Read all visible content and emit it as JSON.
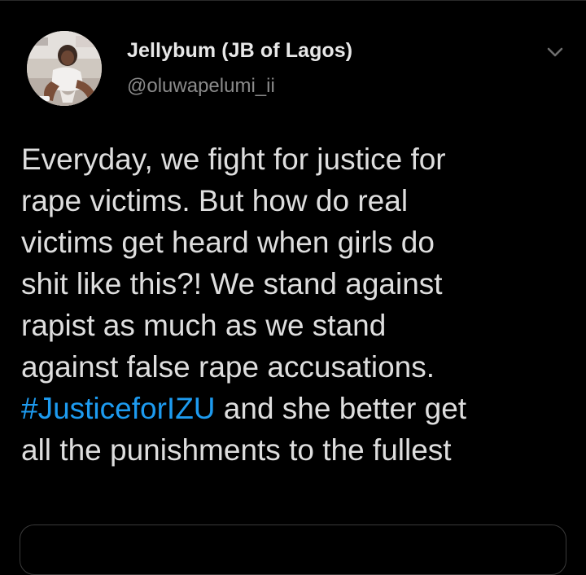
{
  "author": {
    "display_name": "Jellybum (JB of Lagos)",
    "handle": "@oluwapelumi_ii"
  },
  "menu": {
    "icon": "chevron-down-icon"
  },
  "tweet": {
    "lines": [
      "Everyday, we fight for justice for",
      "rape victims. But how do real",
      "victims get heard when girls do",
      "shit like this?! We stand against",
      "rapist as much as we stand",
      "against false rape accusations."
    ],
    "hashtag": "#JusticeforIZU",
    "hashtag_tail": " and she better get",
    "last_line": "all the punishments to the fullest"
  },
  "colors": {
    "background": "#000000",
    "text": "#dedede",
    "secondary_text": "#8b8b8b",
    "link": "#1d9bf0"
  }
}
